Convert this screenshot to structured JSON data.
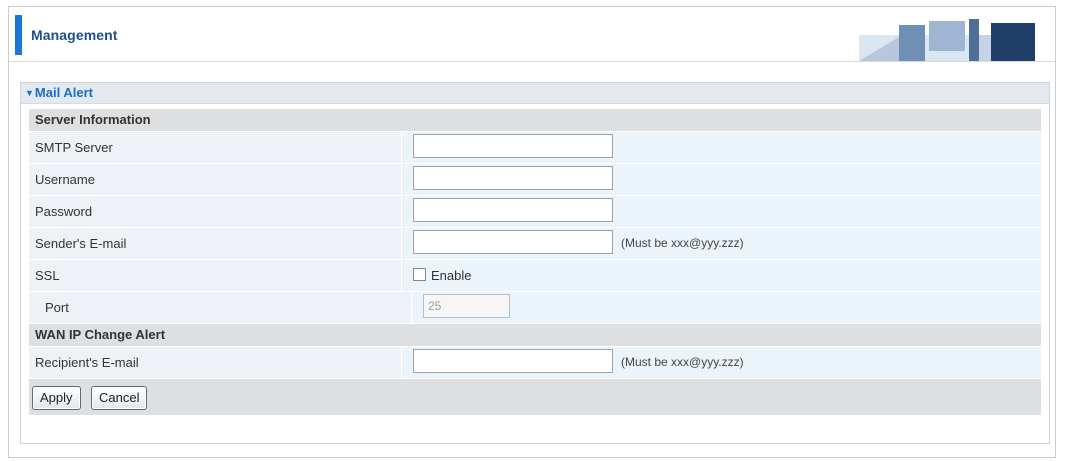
{
  "header": {
    "title": "Management"
  },
  "panel": {
    "title": "Mail Alert"
  },
  "sections": {
    "server_info": "Server Information",
    "wan_ip": "WAN IP Change Alert"
  },
  "fields": {
    "smtp_server": {
      "label": "SMTP Server",
      "value": ""
    },
    "username": {
      "label": "Username",
      "value": ""
    },
    "password": {
      "label": "Password",
      "value": ""
    },
    "sender_email": {
      "label": "Sender's E-mail",
      "value": "",
      "hint": "(Must be xxx@yyy.zzz)"
    },
    "ssl": {
      "label": "SSL",
      "checkbox_label": "Enable",
      "checked": false
    },
    "port": {
      "label": "Port",
      "value": "25"
    },
    "recipient_email": {
      "label": "Recipient's E-mail",
      "value": "",
      "hint": "(Must be xxx@yyy.zzz)"
    }
  },
  "buttons": {
    "apply": "Apply",
    "cancel": "Cancel"
  },
  "colors": {
    "accent": "#1a78d4",
    "title_text": "#1f4f8a",
    "panel_title": "#1a6fc4"
  },
  "icons": {
    "collapse": "triangle-down-icon",
    "header_graphic": "office-scene-graphic"
  }
}
